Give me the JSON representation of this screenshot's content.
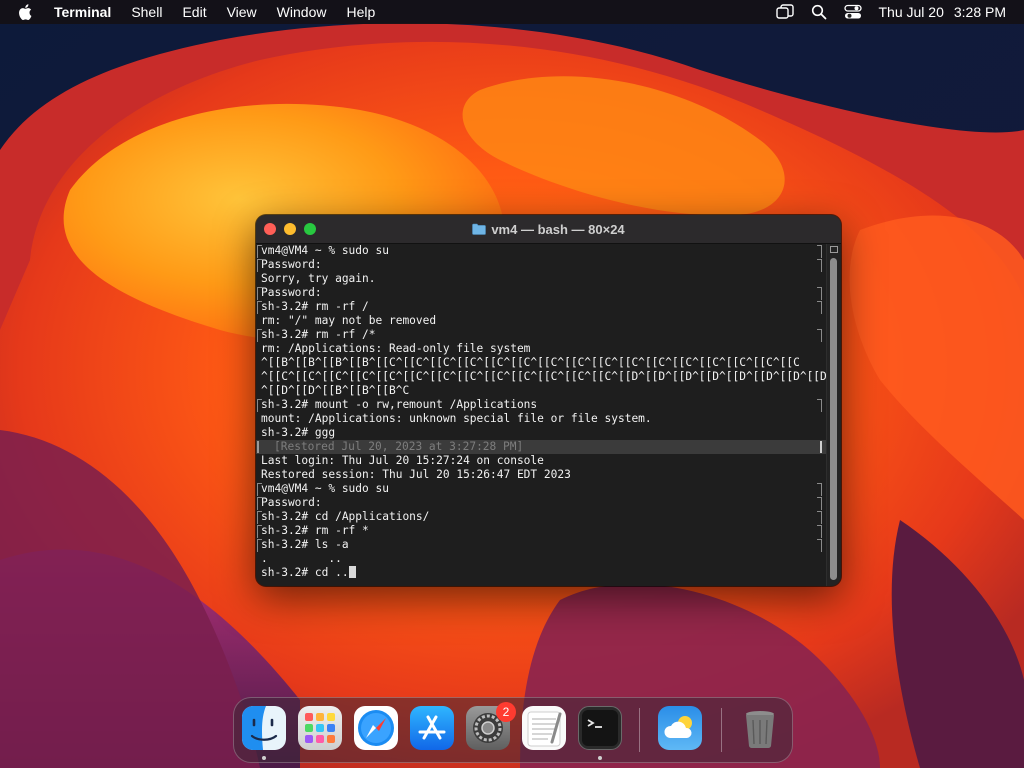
{
  "menubar": {
    "app_name": "Terminal",
    "items": [
      "Shell",
      "Edit",
      "View",
      "Window",
      "Help"
    ],
    "date": "Thu Jul 20",
    "time": "3:28 PM"
  },
  "terminal": {
    "title": "vm4 — bash — 80×24",
    "lines": [
      {
        "text": "vm4@VM4 ~ % sudo su",
        "mark": true
      },
      {
        "text": "Password:",
        "mark": true
      },
      {
        "text": "Sorry, try again.",
        "mark": false
      },
      {
        "text": "Password:",
        "mark": true
      },
      {
        "text": "sh-3.2# rm -rf /",
        "mark": true
      },
      {
        "text": "rm: \"/\" may not be removed",
        "mark": false
      },
      {
        "text": "sh-3.2# rm -rf /*",
        "mark": true
      },
      {
        "text": "rm: /Applications: Read-only file system",
        "mark": false
      },
      {
        "text": "^[[B^[[B^[[B^[[B^[[C^[[C^[[C^[[C^[[C^[[C^[[C^[[C^[[C^[[C^[[C^[[C^[[C^[[C^[[C^[[C",
        "mark": false
      },
      {
        "text": "^[[C^[[C^[[C^[[C^[[C^[[C^[[C^[[C^[[C^[[C^[[C^[[C^[[C^[[D^[[D^[[D^[[D^[[D^[[D^[[D^[[D",
        "mark": false
      },
      {
        "text": "^[[D^[[D^[[B^[[B^[[B^C",
        "mark": false
      },
      {
        "text": "sh-3.2# mount -o rw,remount /Applications",
        "mark": true
      },
      {
        "text": "mount: /Applications: unknown special file or file system.",
        "mark": false
      },
      {
        "text": "sh-3.2# ggg",
        "mark": false
      },
      {
        "text": "[Restored Jul 20, 2023 at 3:27:28 PM]",
        "mark": false,
        "restored": true
      },
      {
        "text": "Last login: Thu Jul 20 15:27:24 on console",
        "mark": false
      },
      {
        "text": "Restored session: Thu Jul 20 15:26:47 EDT 2023",
        "mark": false
      },
      {
        "text": "vm4@VM4 ~ % sudo su",
        "mark": true
      },
      {
        "text": "Password:",
        "mark": true
      },
      {
        "text": "sh-3.2# cd /Applications/",
        "mark": true
      },
      {
        "text": "sh-3.2# rm -rf *",
        "mark": true
      },
      {
        "text": "sh-3.2# ls -a",
        "mark": true
      },
      {
        "text": ".         ..",
        "mark": false
      },
      {
        "text": "sh-3.2# cd ..",
        "mark": false,
        "cursor": true
      }
    ]
  },
  "dock": {
    "apps": [
      "finder",
      "launchpad",
      "safari",
      "app-store",
      "system-settings",
      "textedit",
      "terminal",
      "weather",
      "trash"
    ],
    "settings_badge": "2"
  },
  "colors": {
    "accent_close": "#ff5f57",
    "accent_minimize": "#febc2e",
    "accent_zoom": "#28c840",
    "terminal_bg": "#1e1e1e"
  }
}
